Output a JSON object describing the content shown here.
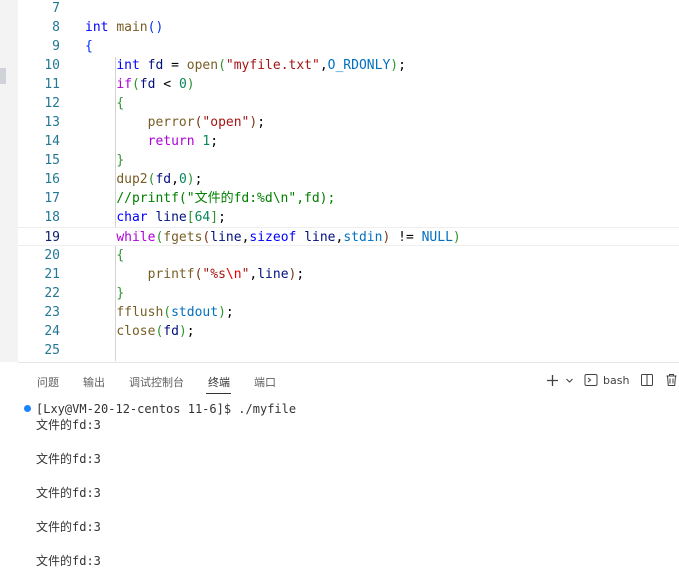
{
  "editor": {
    "lines": [
      {
        "num": "7",
        "code": ""
      },
      {
        "num": "8",
        "code": "int main()"
      },
      {
        "num": "9",
        "code": "{"
      },
      {
        "num": "10",
        "code": "    int fd = open(\"myfile.txt\",O_RDONLY);"
      },
      {
        "num": "11",
        "code": "    if(fd < 0)"
      },
      {
        "num": "12",
        "code": "    {"
      },
      {
        "num": "13",
        "code": "        perror(\"open\");"
      },
      {
        "num": "14",
        "code": "        return 1;"
      },
      {
        "num": "15",
        "code": "    }"
      },
      {
        "num": "16",
        "code": "    dup2(fd,0);"
      },
      {
        "num": "17",
        "code": "    //printf(\"文件的fd:%d\\n\",fd);"
      },
      {
        "num": "18",
        "code": "    char line[64];"
      },
      {
        "num": "19",
        "code": "    while(fgets(line,sizeof line,stdin) != NULL)"
      },
      {
        "num": "20",
        "code": "    {"
      },
      {
        "num": "21",
        "code": "        printf(\"%s\\n\",line);"
      },
      {
        "num": "22",
        "code": "    }"
      },
      {
        "num": "23",
        "code": "    fflush(stdout);"
      },
      {
        "num": "24",
        "code": "    close(fd);"
      },
      {
        "num": "25",
        "code": ""
      }
    ],
    "current_line": "19"
  },
  "panel": {
    "tabs": [
      {
        "label": "问题"
      },
      {
        "label": "输出"
      },
      {
        "label": "调试控制台"
      },
      {
        "label": "终端"
      },
      {
        "label": "端口"
      }
    ],
    "active_tab": "终端",
    "add_icon": "plus-icon",
    "chevron_icon": "chevron-down-icon",
    "shell_icon": "terminal-icon",
    "shell_label": "bash",
    "split_icon": "split-icon",
    "trash_icon": "trash-icon"
  },
  "terminal": {
    "prompt": "[Lxy@VM-20-12-centos 11-6]$ ./myfile",
    "output": [
      "文件的fd:3",
      "",
      "文件的fd:3",
      "",
      "文件的fd:3",
      "",
      "文件的fd:3",
      "",
      "文件的fd:3"
    ]
  },
  "colors": {
    "accent_dot": "#1a85ff",
    "line_number": "#237893",
    "keyword": "#0000ff",
    "control": "#af00db",
    "string": "#a31515",
    "comment": "#008000"
  }
}
